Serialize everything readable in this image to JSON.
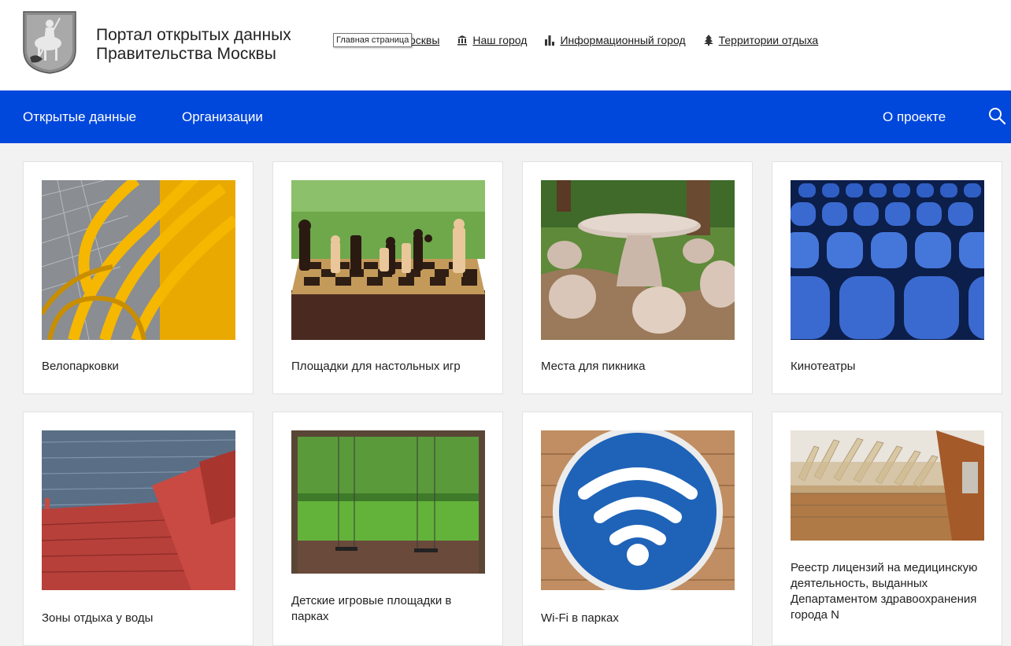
{
  "header": {
    "title_line1": "Портал открытых данных",
    "title_line2": "Правительства Москвы",
    "tooltip": "Главная страница",
    "links": [
      {
        "label": "ельство Москвы",
        "icon": "building-icon"
      },
      {
        "label": "Наш город",
        "icon": "columns-icon"
      },
      {
        "label": "Информационный город",
        "icon": "bar-chart-icon"
      },
      {
        "label": "Территории отдыха",
        "icon": "tree-icon"
      }
    ]
  },
  "nav": {
    "open_data": "Открытые данные",
    "organizations": "Организации",
    "about": "О проекте"
  },
  "cards": [
    {
      "label": "Велопарковки",
      "image": "yellow-bike-racks"
    },
    {
      "label": "Площадки для настольных игр",
      "image": "chess-board"
    },
    {
      "label": "Места для пикника",
      "image": "stone-picnic-table"
    },
    {
      "label": "Кинотеатры",
      "image": "blue-cinema-seats"
    },
    {
      "label": "Зоны отдыха у воды",
      "image": "red-bench-by-water"
    },
    {
      "label": "Детские игровые площадки в парках",
      "image": "park-swings"
    },
    {
      "label": "Wi-Fi в парках",
      "image": "wifi-sign"
    },
    {
      "label": "Реестр лицензий на медицинскую деятельность, выданных Департаментом здравоохранения города N",
      "image": "file-cabinet"
    }
  ],
  "colors": {
    "nav_bg": "#0047dc",
    "page_bg": "#f2f2f2"
  }
}
